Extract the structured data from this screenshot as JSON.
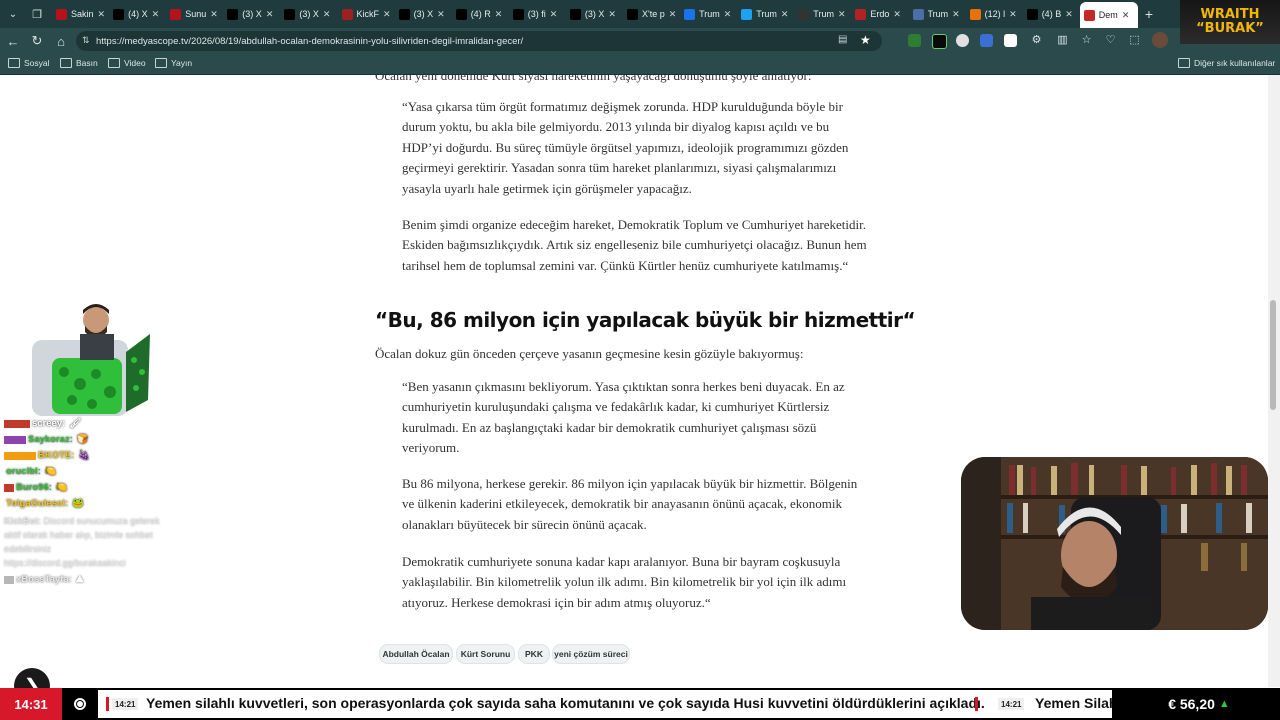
{
  "browser": {
    "tabs": [
      {
        "label": "Sakin",
        "color": "#b5121b"
      },
      {
        "label": "(4) X",
        "color": "#000000"
      },
      {
        "label": "Sunu",
        "color": "#b5121b"
      },
      {
        "label": "(3) X",
        "color": "#000000"
      },
      {
        "label": "(3) X",
        "color": "#000000"
      },
      {
        "label": "KickF",
        "color": "#a01f1f"
      },
      {
        "label": "(3) X",
        "color": "#000000"
      },
      {
        "label": "(4) R",
        "color": "#000000"
      },
      {
        "label": "(3) fi",
        "color": "#000000"
      },
      {
        "label": "(3) X",
        "color": "#000000"
      },
      {
        "label": "X'te p",
        "color": "#000000"
      },
      {
        "label": "Trum",
        "color": "#1a73e8"
      },
      {
        "label": "Trum",
        "color": "#1da1f2"
      },
      {
        "label": "Trum",
        "color": "#333333"
      },
      {
        "label": "Erdo",
        "color": "#b22222"
      },
      {
        "label": "Trum",
        "color": "#4a6fa5"
      },
      {
        "label": "(12) l",
        "color": "#e8710a"
      },
      {
        "label": "(4) B",
        "color": "#000000"
      },
      {
        "label": "Dem",
        "color": "#c62828"
      }
    ],
    "active_tab_index": 18,
    "url": "https://medyascope.tv/2026/08/19/abdullah-ocalan-demokrasinin-yolu-silivriden-degil-imralidan-gecer/",
    "bookmarks": [
      "Sosyal",
      "Basın",
      "Video",
      "Yayın"
    ],
    "other_bookmarks": "Diğer sık kullanılanlar"
  },
  "overlay": {
    "badge_line1": "WRAITH",
    "badge_line2": "“BURAK”",
    "chat": [
      {
        "user": "screey:",
        "color": "#ffffff",
        "msg": "🖌"
      },
      {
        "user": "Saykoraz:",
        "color": "#35c23a",
        "msg": "🍞"
      },
      {
        "user": "BKOTE:",
        "color": "#f0c419",
        "msg": "🍇"
      },
      {
        "user": "oruclbl:",
        "color": "#35c23a",
        "msg": "🍋"
      },
      {
        "user": "Buro96:",
        "color": "#35c23a",
        "msg": "🍋"
      },
      {
        "user": "TolgaGulesci:",
        "color": "#f0c419",
        "msg": "🐸"
      }
    ],
    "kickbot_user": "KickBot:",
    "kickbot_msg": "Discord sunucumuza gelerek aktif olarak haber alıp, bizimle sohbet edebilirsiniz https://discord.gg/burakaakinci",
    "last_user": "xBossTayfa:",
    "last_msg": "⛰"
  },
  "article": {
    "intro": "Öcalan yeni dönemde Kürt siyasi hareketinin yaşayacağı dönüşümü şöyle anlatıyor:",
    "quote1_p1": "“Yasa çıkarsa tüm örgüt formatımız değişmek zorunda. HDP kurulduğunda böyle bir durum yoktu, bu akla bile gelmiyordu. 2013 yılında bir diyalog kapısı açıldı ve bu HDP’yi doğurdu. Bu süreç tümüyle örgütsel yapımızı, ideolojik programımızı gözden geçirmeyi gerektirir. Yasadan sonra tüm hareket planlarımızı, siyasi çalışmalarımızı yasayla uyarlı hale getirmek için görüşmeler yapacağız.",
    "quote1_p2": "Benim şimdi organize edeceğim hareket, Demokratik Toplum ve Cumhuriyet hareketidir. Eskiden bağımsızlıkçıydık. Artık siz engelleseniz bile cumhuriyetçi olacağız. Bunun hem tarihsel hem de toplumsal zemini var. Çünkü Kürtler henüz cumhuriyete katılmamış.“",
    "subheading": "“Bu, 86 milyon için yapılacak büyük bir hizmettir“",
    "lead2": "Öcalan dokuz gün önceden çerçeve yasanın geçmesine kesin gözüyle bakıyormuş:",
    "quote2_p1": "“Ben yasanın çıkmasını bekliyorum. Yasa çıktıktan sonra herkes beni duyacak. En az cumhuriyetin kuruluşundaki çalışma ve fedakârlık kadar, ki cumhuriyet Kürtlersiz kurulmadı. En az başlangıçtaki kadar bir demokratik cumhuriyet çalışması sözü veriyorum.",
    "quote2_p2": "Bu 86 milyona, herkese gerekir. 86 milyon için yapılacak büyük bir hizmettir. Bölgenin ve ülkenin kaderini etkileyecek, demokratik bir anayasanın önünü açacak, ekonomik olanakları büyütecek bir sürecin önünü açacak.",
    "quote2_p3": "Demokratik cumhuriyete sonuna kadar kapı aralanıyor. Buna bir bayram coşkusuyla yaklaşılabilir. Bin kilometrelik yolun ilk adımı. Bin kilometrelik bir yol için ilk adımı atıyoruz. Herkese demokrasi için bir adım atmış oluyoruz.“",
    "tags": [
      "Abdullah Öcalan",
      "Kürt Sorunu",
      "PKK",
      "yeni çözüm süreci"
    ]
  },
  "ticker": {
    "clock": "14:31",
    "time1": "14:21",
    "headline1": "Yemen silahlı kuvvetleri, son operasyonlarda çok sayıda saha komutanını ve çok sayıda Husi kuvvetini öldürdüklerini açıkladı.",
    "time2": "14:21",
    "headline2": "Yemen Silahlı",
    "euro": "€ 56,20",
    "euro_trend": "▲"
  }
}
